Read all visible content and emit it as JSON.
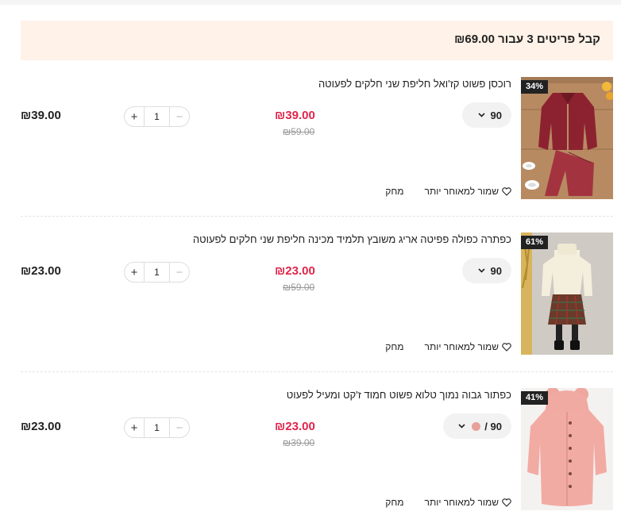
{
  "promo": {
    "text": "קבל פריטים 3 עבור ₪69.00"
  },
  "items": [
    {
      "title": "רוכסן פשוט קז'ואל חליפת שני חלקים לפעוטה",
      "discount": "34%",
      "variant": "90",
      "price": "₪39.00",
      "old_price": "₪59.00",
      "quantity": "1",
      "subtotal": "₪39.00",
      "save_label": "שמור למאוחר יותר",
      "delete_label": "מחק"
    },
    {
      "title": "כפתרה כפולה פפיטה אריג משובץ תלמיד מכינה חליפת שני חלקים לפעוטה",
      "discount": "61%",
      "variant": "90",
      "price": "₪23.00",
      "old_price": "₪59.00",
      "quantity": "1",
      "subtotal": "₪23.00",
      "save_label": "שמור למאוחר יותר",
      "delete_label": "מחק"
    },
    {
      "title": "כפתור גבוה נמוך טלוא פשוט חמוד ז'קט ומעיל לפעוט",
      "discount": "41%",
      "variant": "90 /",
      "price": "₪23.00",
      "old_price": "₪39.00",
      "quantity": "1",
      "subtotal": "₪23.00",
      "save_label": "שמור למאוחר יותר",
      "delete_label": "מחק"
    }
  ],
  "stepper": {
    "minus": "−",
    "plus": "+"
  },
  "colors": {
    "sale_price": "#e0254b",
    "promo_bg": "#fff2e8",
    "badge_bg": "#222222"
  }
}
